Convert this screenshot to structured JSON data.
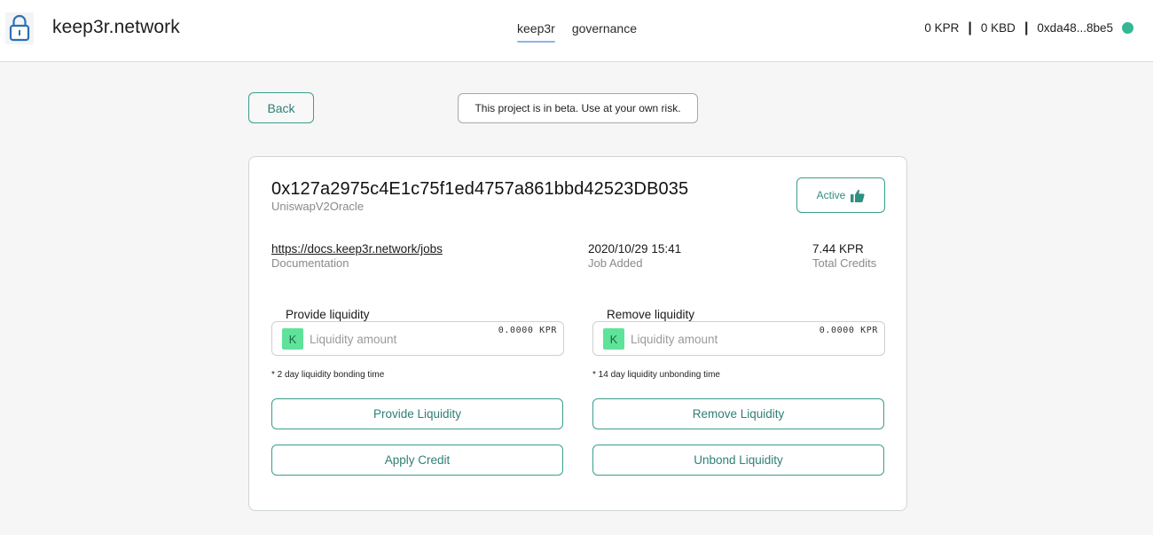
{
  "header": {
    "brand": "keep3r.network",
    "nav": [
      {
        "label": "keep3r",
        "active": true
      },
      {
        "label": "governance",
        "active": false
      }
    ],
    "wallet": {
      "kpr_balance": "0 KPR",
      "kbd_balance": "0 KBD",
      "address": "0xda48...8be5",
      "status_color": "#33b893"
    }
  },
  "top": {
    "back_label": "Back",
    "beta_notice": "This project is in beta. Use at your own risk."
  },
  "job": {
    "address": "0x127a2975c4E1c75f1ed4757a861bbd42523DB035",
    "name": "UniswapV2Oracle",
    "status_label": "Active",
    "status_icon": "thumbs-up-icon",
    "documentation": {
      "value": "https://docs.keep3r.network/jobs",
      "label": "Documentation"
    },
    "added": {
      "value": "2020/10/29 15:41",
      "label": "Job Added"
    },
    "credits": {
      "value": "7.44 KPR",
      "label": "Total Credits"
    }
  },
  "provide": {
    "title": "Provide liquidity",
    "token_letter": "K",
    "placeholder": "Liquidity amount",
    "balance": "0.0000 KPR",
    "note": "* 2 day liquidity bonding time",
    "primary_button": "Provide Liquidity",
    "secondary_button": "Apply Credit"
  },
  "remove": {
    "title": "Remove liquidity",
    "token_letter": "K",
    "placeholder": "Liquidity amount",
    "balance": "0.0000 KPR",
    "note": "* 14 day liquidity unbonding time",
    "primary_button": "Remove Liquidity",
    "secondary_button": "Unbond Liquidity"
  },
  "colors": {
    "accent": "#3a9e8c",
    "token_badge": "#5fe39a",
    "nav_underline": "#8fb2e6"
  }
}
